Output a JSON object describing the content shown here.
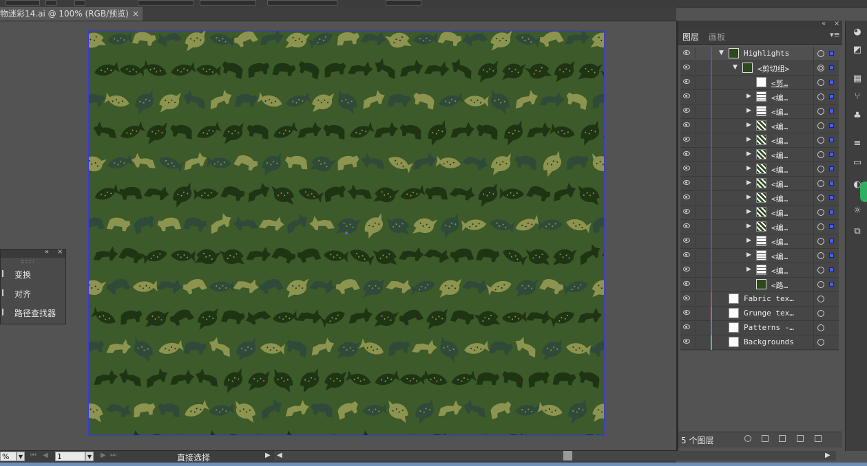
{
  "document": {
    "tab_title": "物迷彩14.ai @ 100% (RGB/预览)",
    "close_glyph": "×"
  },
  "floating_panel": {
    "items": [
      {
        "label": "变换",
        "icon": "transform-icon"
      },
      {
        "label": "对齐",
        "icon": "align-icon"
      },
      {
        "label": "路径查找器",
        "icon": "pathfinder-icon"
      }
    ]
  },
  "status_bar": {
    "zoom": "%",
    "artboard_number": "1",
    "tool_name": "直接选择"
  },
  "layers_panel": {
    "tabs": [
      "图层",
      "画板"
    ],
    "footer_count": "5 个图层",
    "rows": [
      {
        "name": "Highlights",
        "indent": 0,
        "expander": "down",
        "thumb": "green",
        "color": "#4a55d8",
        "target": "single",
        "selected": true,
        "depth_bar": true
      },
      {
        "name": "<剪切组>",
        "indent": 1,
        "expander": "down",
        "thumb": "green",
        "color": "#4a55d8",
        "target": "double",
        "selected": true
      },
      {
        "name": "<剪…",
        "indent": 2,
        "expander": "none",
        "thumb": "white",
        "color": "#4a55d8",
        "target": "single",
        "selected": true,
        "underline": true
      },
      {
        "name": "<编…",
        "indent": 2,
        "expander": "right",
        "thumb": "lines",
        "color": "#4a55d8",
        "target": "single",
        "selected": true
      },
      {
        "name": "<编…",
        "indent": 2,
        "expander": "right",
        "thumb": "lines",
        "color": "#4a55d8",
        "target": "single",
        "selected": true
      },
      {
        "name": "<编…",
        "indent": 2,
        "expander": "right",
        "thumb": "pattern",
        "color": "#4a55d8",
        "target": "single",
        "selected": true
      },
      {
        "name": "<编…",
        "indent": 2,
        "expander": "right",
        "thumb": "pattern",
        "color": "#4a55d8",
        "target": "single",
        "selected": true
      },
      {
        "name": "<编…",
        "indent": 2,
        "expander": "right",
        "thumb": "pattern",
        "color": "#4a55d8",
        "target": "single",
        "selected": true
      },
      {
        "name": "<编…",
        "indent": 2,
        "expander": "right",
        "thumb": "pattern",
        "color": "#4a55d8",
        "target": "single",
        "selected": true
      },
      {
        "name": "<编…",
        "indent": 2,
        "expander": "right",
        "thumb": "pattern",
        "color": "#4a55d8",
        "target": "single",
        "selected": true
      },
      {
        "name": "<编…",
        "indent": 2,
        "expander": "right",
        "thumb": "pattern",
        "color": "#4a55d8",
        "target": "single",
        "selected": true
      },
      {
        "name": "<编…",
        "indent": 2,
        "expander": "right",
        "thumb": "pattern",
        "color": "#4a55d8",
        "target": "single",
        "selected": true
      },
      {
        "name": "<编…",
        "indent": 2,
        "expander": "right",
        "thumb": "pattern",
        "color": "#4a55d8",
        "target": "single",
        "selected": true
      },
      {
        "name": "<编…",
        "indent": 2,
        "expander": "right",
        "thumb": "lines",
        "color": "#4a55d8",
        "target": "single",
        "selected": true
      },
      {
        "name": "<编…",
        "indent": 2,
        "expander": "right",
        "thumb": "lines",
        "color": "#4a55d8",
        "target": "single",
        "selected": true
      },
      {
        "name": "<编…",
        "indent": 2,
        "expander": "right",
        "thumb": "lines",
        "color": "#4a55d8",
        "target": "single",
        "selected": true
      },
      {
        "name": "<路…",
        "indent": 2,
        "expander": "none",
        "thumb": "green",
        "color": "#4a55d8",
        "target": "single",
        "selected": true
      },
      {
        "name": "Fabric tex…",
        "indent": 0,
        "expander": "none",
        "thumb": "white",
        "color": "#e0413c",
        "target": "single",
        "selected": false
      },
      {
        "name": "Grunge tex…",
        "indent": 0,
        "expander": "none",
        "thumb": "white",
        "color": "#e040c8",
        "target": "single",
        "selected": false
      },
      {
        "name": "Patterns -…",
        "indent": 0,
        "expander": "none",
        "thumb": "white",
        "color": "#4a7ee0",
        "target": "single",
        "selected": false
      },
      {
        "name": "Backgrounds",
        "indent": 0,
        "expander": "none",
        "thumb": "white",
        "color": "#3cd06a",
        "target": "single",
        "selected": false
      }
    ]
  },
  "colors": {
    "artboard_bg": "#3c5a2a",
    "motif_khaki": "#8d9450",
    "motif_dark": "#1f3413",
    "motif_teal": "#2f4a39",
    "selection_blue": "#4b5cf5"
  }
}
